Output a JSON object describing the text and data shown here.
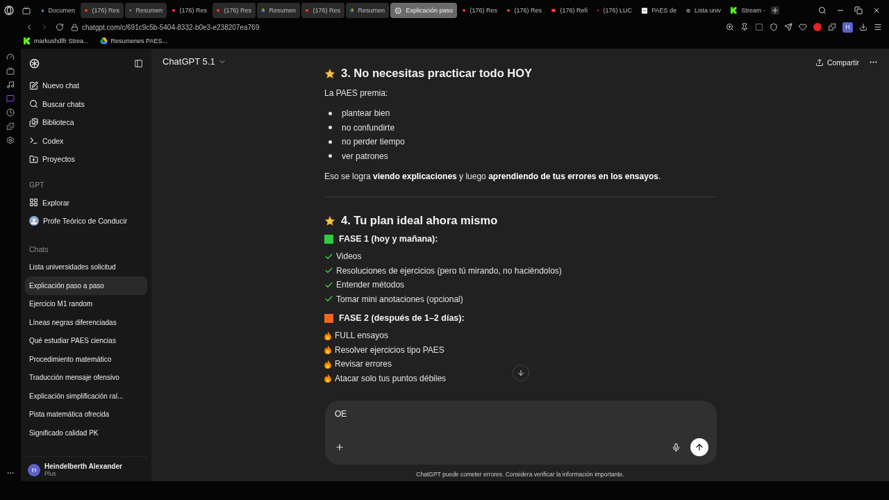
{
  "browser": {
    "tabs": [
      {
        "title": "Documen",
        "kind": "doc",
        "grouped": false,
        "selected": false
      },
      {
        "title": "(176) Res",
        "kind": "video",
        "grouped": true,
        "selected": false
      },
      {
        "title": "Resumen",
        "kind": "drive",
        "grouped": true,
        "selected": false
      },
      {
        "title": "(176) Res",
        "kind": "video",
        "grouped": false,
        "selected": false
      },
      {
        "title": "(176) Res",
        "kind": "video",
        "grouped": true,
        "selected": false
      },
      {
        "title": "Resumen",
        "kind": "drive",
        "grouped": true,
        "selected": false
      },
      {
        "title": "(176) Res",
        "kind": "video",
        "grouped": true,
        "selected": false
      },
      {
        "title": "Resumen",
        "kind": "drive",
        "grouped": true,
        "selected": false
      },
      {
        "title": "Explicación paso",
        "kind": "chat",
        "grouped": false,
        "selected": true
      },
      {
        "title": "(176) Res",
        "kind": "video",
        "grouped": false,
        "selected": false
      },
      {
        "title": "(176) Res",
        "kind": "video",
        "grouped": false,
        "selected": false
      },
      {
        "title": "(176) Refi",
        "kind": "video",
        "grouped": false,
        "selected": false
      },
      {
        "title": "(176) LUC",
        "kind": "video",
        "grouped": false,
        "selected": false
      },
      {
        "title": "PAES de",
        "kind": "page",
        "grouped": false,
        "selected": false
      },
      {
        "title": "Lista univ",
        "kind": "chat",
        "grouped": false,
        "selected": false
      },
      {
        "title": "Stream -",
        "kind": "stream",
        "grouped": false,
        "selected": false
      }
    ],
    "url": "chatgpt.com/c/691c9c5b-5404-8332-b0e3-e238207ea769",
    "profile_initial": "H",
    "bookmarks": [
      {
        "title": "markushdlfr Strea...",
        "kind": "stream"
      },
      {
        "title": "Resumenes PAES...",
        "kind": "drive"
      }
    ]
  },
  "sidebar": {
    "nav": [
      {
        "label": "Nuevo chat",
        "kind": "new"
      },
      {
        "label": "Buscar chats",
        "kind": "search"
      },
      {
        "label": "Biblioteca",
        "kind": "library"
      },
      {
        "label": "Codex",
        "kind": "codex"
      },
      {
        "label": "Proyectos",
        "kind": "projects"
      }
    ],
    "gpt_heading": "GPT",
    "gpts": [
      {
        "label": "Explorar",
        "kind": "explore"
      },
      {
        "label": "Profe Teórico de Conducir",
        "kind": "avatar"
      }
    ],
    "chats_heading": "Chats",
    "chats": [
      {
        "label": "Lista universidades solicitud",
        "selected": false
      },
      {
        "label": "Explicación paso a paso",
        "selected": true
      },
      {
        "label": "Ejercicio M1 random",
        "selected": false
      },
      {
        "label": "Líneas negras diferenciadas",
        "selected": false
      },
      {
        "label": "Qué estudiar PAES ciencias",
        "selected": false
      },
      {
        "label": "Procedimiento matemático",
        "selected": false
      },
      {
        "label": "Traducción mensaje ofensivo",
        "selected": false
      },
      {
        "label": "Explicación simplificación raí...",
        "selected": false
      },
      {
        "label": "Pista matemática ofrecida",
        "selected": false
      },
      {
        "label": "Significado calidad PK",
        "selected": false
      }
    ],
    "user": {
      "initial": "H",
      "name": "Heindelberth Alexander",
      "plan": "Plus"
    }
  },
  "header": {
    "model": "ChatGPT 5.1",
    "share": "Compartir"
  },
  "message": [
    {
      "kind": "heading",
      "text": "3. No necesitas practicar todo HOY"
    },
    {
      "kind": "paragraph",
      "text": "La PAES premia:"
    },
    {
      "kind": "bullets",
      "items": [
        "plantear bien",
        "no confundirte",
        "no perder tiempo",
        "ver patrones"
      ]
    },
    {
      "kind": "paragraph",
      "text": "Eso se logra **viendo explicaciones** y luego **aprendiendo de tus errores en los ensayos**."
    },
    {
      "kind": "divider"
    },
    {
      "kind": "heading",
      "text": "4. Tu plan ideal ahora mismo"
    },
    {
      "kind": "phase",
      "text": "FASE 1 (hoy y mañana):",
      "color": "#2ecc40"
    },
    {
      "kind": "checks",
      "items": [
        "Videos",
        "Resoluciones de ejercicios (pero tú mirando, no haciéndolos)",
        "Entender métodos",
        "Tomar mini anotaciones (opcional)"
      ]
    },
    {
      "kind": "phase",
      "text": "FASE 2 (después de 1–2 días):",
      "color": "#f2651c"
    },
    {
      "kind": "fires",
      "items": [
        "FULL ensayos",
        "Resolver ejercicios tipo PAES",
        "Revisar errores",
        "Atacar solo tus puntos débiles"
      ]
    }
  ],
  "composer": {
    "value": "OE"
  },
  "disclaimer": "ChatGPT puede cometer errores. Considera verificar la información importante."
}
